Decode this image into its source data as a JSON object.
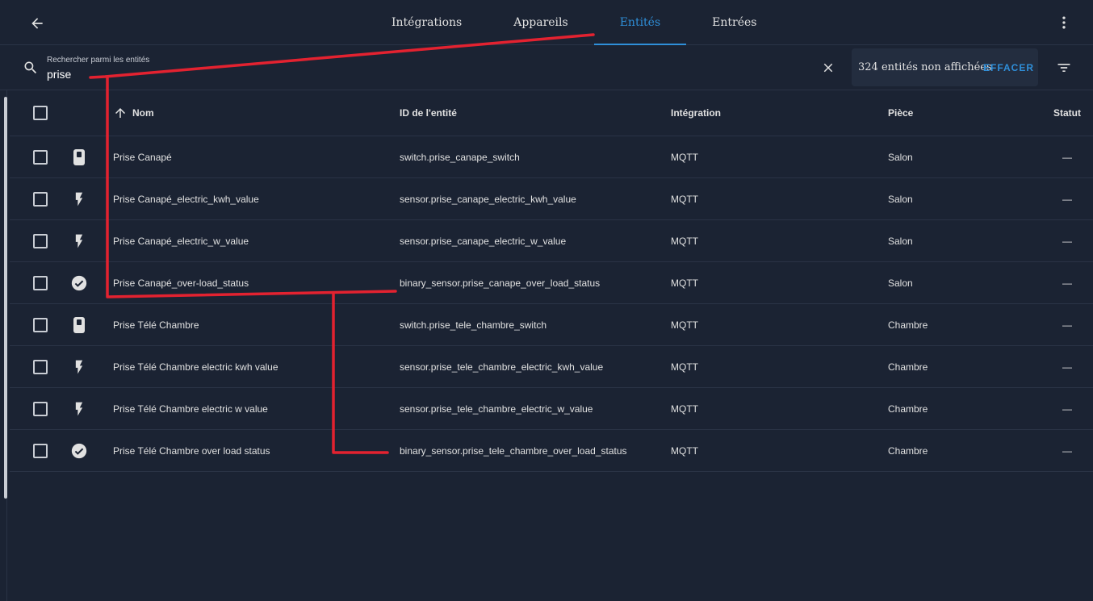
{
  "tabs": [
    {
      "label": "Intégrations"
    },
    {
      "label": "Appareils"
    },
    {
      "label": "Entités"
    },
    {
      "label": "Entrées"
    }
  ],
  "search": {
    "label": "Rechercher parmi les entités",
    "value": "prise"
  },
  "filter_info": {
    "hidden_text": "324 entités non affichées",
    "clear_label": "EFFACER"
  },
  "table": {
    "columns": {
      "name": "Nom",
      "entity_id": "ID de l'entité",
      "integration": "Intégration",
      "area": "Pièce",
      "status": "Statut"
    },
    "rows": [
      {
        "icon": "switch-icon",
        "name": "Prise Canapé",
        "entity_id": "switch.prise_canape_switch",
        "integration": "MQTT",
        "area": "Salon",
        "status": "—"
      },
      {
        "icon": "flash-icon",
        "name": "Prise Canapé_electric_kwh_value",
        "entity_id": "sensor.prise_canape_electric_kwh_value",
        "integration": "MQTT",
        "area": "Salon",
        "status": "—"
      },
      {
        "icon": "flash-icon",
        "name": "Prise Canapé_electric_w_value",
        "entity_id": "sensor.prise_canape_electric_w_value",
        "integration": "MQTT",
        "area": "Salon",
        "status": "—"
      },
      {
        "icon": "check-circle-icon",
        "name": "Prise Canapé_over-load_status",
        "entity_id": "binary_sensor.prise_canape_over_load_status",
        "integration": "MQTT",
        "area": "Salon",
        "status": "—"
      },
      {
        "icon": "switch-icon",
        "name": "Prise Télé Chambre",
        "entity_id": "switch.prise_tele_chambre_switch",
        "integration": "MQTT",
        "area": "Chambre",
        "status": "—"
      },
      {
        "icon": "flash-icon",
        "name": "Prise Télé Chambre electric kwh value",
        "entity_id": "sensor.prise_tele_chambre_electric_kwh_value",
        "integration": "MQTT",
        "area": "Chambre",
        "status": "—"
      },
      {
        "icon": "flash-icon",
        "name": "Prise Télé Chambre electric w value",
        "entity_id": "sensor.prise_tele_chambre_electric_w_value",
        "integration": "MQTT",
        "area": "Chambre",
        "status": "—"
      },
      {
        "icon": "check-circle-icon",
        "name": "Prise Télé Chambre over load status",
        "entity_id": "binary_sensor.prise_tele_chambre_over_load_status",
        "integration": "MQTT",
        "area": "Chambre",
        "status": "—"
      }
    ]
  },
  "colors": {
    "background": "#1b2333",
    "accent": "#2f8fd9",
    "annotation": "#e32230"
  }
}
